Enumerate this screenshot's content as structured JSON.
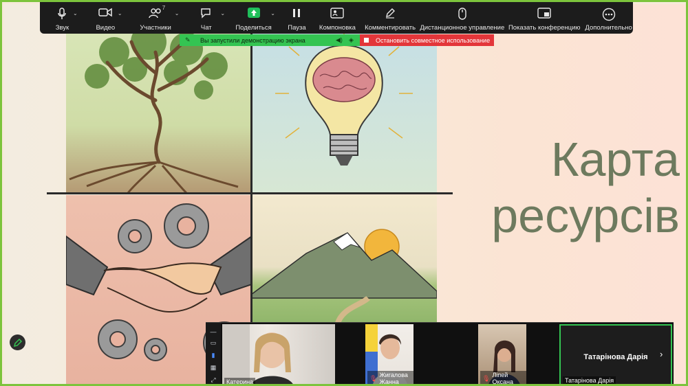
{
  "toolbar": {
    "items": [
      {
        "label": "Звук",
        "icon": "microphone-icon",
        "caret": true
      },
      {
        "label": "Видео",
        "icon": "video-camera-icon",
        "caret": true
      },
      {
        "label": "Участники",
        "icon": "participants-icon",
        "caret": true,
        "count": "7"
      },
      {
        "label": "Чат",
        "icon": "chat-icon",
        "caret": true
      },
      {
        "label": "Поделиться",
        "icon": "share-screen-icon",
        "caret": true
      },
      {
        "label": "Пауза",
        "icon": "pause-icon",
        "caret": false
      },
      {
        "label": "Компоновка",
        "icon": "layout-icon",
        "caret": false
      },
      {
        "label": "Комментировать",
        "icon": "annotate-icon",
        "caret": false
      },
      {
        "label": "Дистанционное управление",
        "icon": "remote-control-icon",
        "caret": false
      },
      {
        "label": "Показать конференцию",
        "icon": "show-meeting-icon",
        "caret": false
      },
      {
        "label": "Дополнительно",
        "icon": "more-icon",
        "caret": false
      }
    ]
  },
  "share_status": {
    "message": "Вы запустили демонстрацию экрана",
    "stop_label": "Остановить совместное использование",
    "color": "#34c452",
    "stop_color": "#e3363a"
  },
  "slide": {
    "title_line1": "Карта",
    "title_line2": "ресурсів",
    "title_color": "#6d7a5e"
  },
  "video_strip": {
    "tiles": [
      {
        "name": "Катерина",
        "muted": false
      },
      {
        "name": "Жигалова Жанна",
        "muted": true
      },
      {
        "name": "Лiпей Оксана",
        "muted": true
      },
      {
        "name": "Татарінова Дарія",
        "muted": false,
        "active_speaker": true
      }
    ],
    "active_big_name": "Татарінова Дарія"
  }
}
